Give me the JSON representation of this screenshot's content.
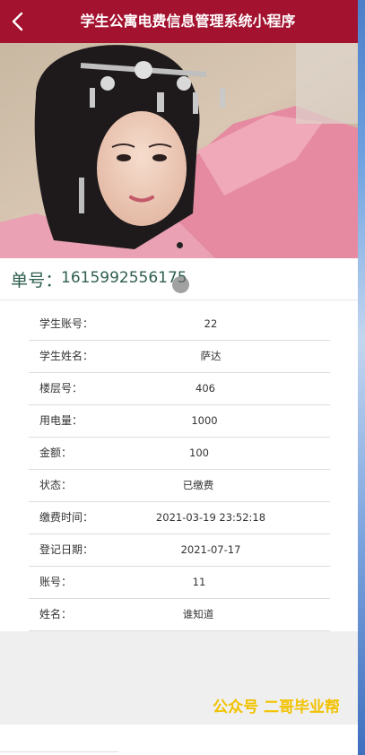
{
  "nav": {
    "title": "学生公寓电费信息管理系统小程序"
  },
  "order": {
    "label": "单号：",
    "number": "1615992556175"
  },
  "details": [
    {
      "label": "学生账号：",
      "value": "22"
    },
    {
      "label": "学生姓名：",
      "value": "萨达"
    },
    {
      "label": "楼层号：",
      "value": "406"
    },
    {
      "label": "用电量：",
      "value": "1000"
    },
    {
      "label": "金额：",
      "value": "100"
    },
    {
      "label": "状态：",
      "value": "已缴费"
    },
    {
      "label": "缴费时间：",
      "value": "2021-03-19 23:52:18"
    },
    {
      "label": "登记日期：",
      "value": "2021-07-17"
    },
    {
      "label": "账号：",
      "value": "11"
    },
    {
      "label": "姓名：",
      "value": "谁知道"
    }
  ],
  "watermark": "公众号 二哥毕业帮",
  "colors": {
    "navbar": "#a3122f",
    "watermark": "#f2c200"
  },
  "icons": {
    "back": "chevron-left-icon"
  }
}
